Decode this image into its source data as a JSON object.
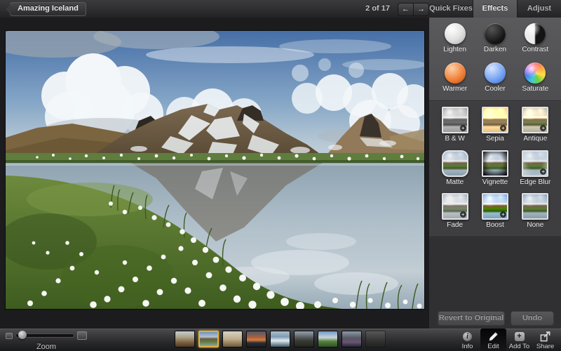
{
  "header": {
    "back_button": "Amazing Iceland",
    "photo_counter": "2 of 17",
    "prev_icon": "←",
    "next_icon": "→"
  },
  "tabs": [
    {
      "label": "Quick Fixes",
      "selected": false
    },
    {
      "label": "Effects",
      "selected": true
    },
    {
      "label": "Adjust",
      "selected": false
    }
  ],
  "effects_panel": {
    "orbs": [
      {
        "label": "Lighten",
        "color": "#f2f2f2"
      },
      {
        "label": "Darken",
        "color": "#161616"
      },
      {
        "label": "Contrast",
        "color": "#e8e8e8"
      },
      {
        "label": "Warmer",
        "color": "#ef7c33"
      },
      {
        "label": "Cooler",
        "color": "#6f9ff0"
      },
      {
        "label": "Saturate",
        "color": "#70d040"
      }
    ],
    "presets": [
      {
        "label": "B & W",
        "badge": "+"
      },
      {
        "label": "Sepia",
        "badge": "+"
      },
      {
        "label": "Antique",
        "badge": "+"
      },
      {
        "label": "Matte",
        "badge": ""
      },
      {
        "label": "Vignette",
        "badge": ""
      },
      {
        "label": "Edge Blur",
        "badge": "+"
      },
      {
        "label": "Fade",
        "badge": "+"
      },
      {
        "label": "Boost",
        "badge": "+"
      },
      {
        "label": "None",
        "badge": ""
      }
    ],
    "revert_button": "Revert to Original",
    "undo_button": "Undo"
  },
  "zoom_control": {
    "label": "Zoom"
  },
  "toolbar": [
    {
      "label": "Info",
      "selected": false
    },
    {
      "label": "Edit",
      "selected": true
    },
    {
      "label": "Add To",
      "selected": false
    },
    {
      "label": "Share",
      "selected": false
    }
  ],
  "icons": {
    "plus": "+",
    "info": "i"
  },
  "filmstrip": {
    "selected_index": 1,
    "selection_color": "#e2b13c",
    "items": [
      {
        "style": "background:linear-gradient(180deg,#c8cdd2 0%,#a99f83 40%,#7d6342 70%,#4e3a26 100%)"
      },
      {
        "style": "background:linear-gradient(180deg,#6f93bd 0%,#b5c3cf 35%,#6d5c45 48%,#5e7c38 68%,#8ea4b2 100%)"
      },
      {
        "style": "background:linear-gradient(180deg,#d8d2c4 0%,#bfae8d 50%,#8d7a58 80%,#6a5940 100%)"
      },
      {
        "style": "background:linear-gradient(180deg,#4a5a74 0%,#b06038 40%,#d4813f 55%,#2c2c34 75%,#1c1c22 100%)"
      },
      {
        "style": "background:linear-gradient(180deg,#aebfcc 0%,#7d9cb2 35%,#e4ebf0 60%,#9fb4c0 75%,#3f5a66 100%)"
      },
      {
        "style": "background:linear-gradient(180deg,#93a2ae 0%,#5c6468 35%,#3a3c34 60%,#22251e 100%)"
      },
      {
        "style": "background:linear-gradient(180deg,#6f9ac9 0%,#c9d3d9 40%,#55803c 65%,#2f5428 100%)"
      },
      {
        "style": "background:linear-gradient(180deg,#8c9aa8 0%,#55555e 45%,#6a5578 70%,#262630 100%)"
      },
      {
        "style": "background:linear-gradient(180deg,#6e6e6a 0%,#44443f 50%,#23231f 100%)"
      }
    ]
  }
}
